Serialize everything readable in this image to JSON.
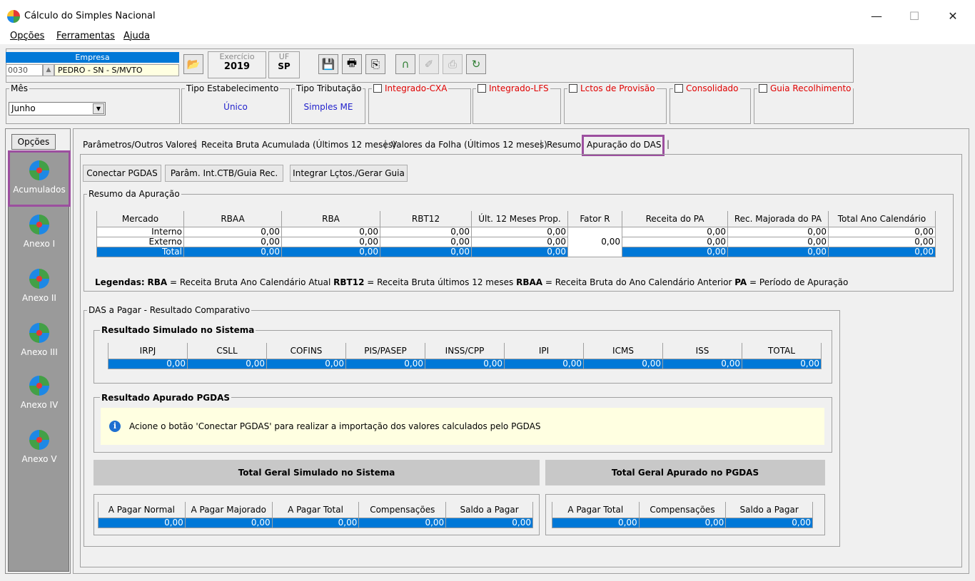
{
  "window": {
    "title": "Cálculo do Simples Nacional",
    "controls": {
      "minimize": "—",
      "maximize": "☐",
      "close": "✕"
    }
  },
  "menu": [
    "Opções",
    "Ferramentas",
    "Ajuda"
  ],
  "toolbar": {
    "empresa_label": "Empresa",
    "empresa_code": "0030",
    "empresa_name": "PEDRO - SN - S/MVTO",
    "exercicio_label": "Exercício",
    "exercicio_value": "2019",
    "uf_label": "UF",
    "uf_value": "SP",
    "icons": [
      "save-icon",
      "print-icon",
      "export-icon",
      "headset-icon",
      "disabled-tool-icon",
      "disabled-tool-icon-2",
      "refresh-icon"
    ]
  },
  "filters": {
    "mes_label": "Mês",
    "mes_value": "Junho",
    "tipo_estab_label": "Tipo Estabelecimento",
    "tipo_estab_value": "Único",
    "tipo_trib_label": "Tipo Tributação",
    "tipo_trib_value": "Simples ME",
    "checkboxes": [
      "Integrado-CXA",
      "Integrado-LFS",
      "Lctos de Provisão",
      "Consolidado",
      "Guia Recolhimento"
    ]
  },
  "sidebar": {
    "options_label": "Opções",
    "items": [
      "Acumulados",
      "Anexo I",
      "Anexo II",
      "Anexo III",
      "Anexo IV",
      "Anexo V"
    ]
  },
  "tabs": [
    "Parâmetros/Outros Valores",
    "Receita Bruta Acumulada (Últimos 12 meses)",
    "Valores da Folha (Últimos 12 meses)",
    "Resumo",
    "Apuração do DAS"
  ],
  "actions": [
    "Conectar PGDAS",
    "Parâm. Int.CTB/Guia Rec.",
    "Integrar Lçtos./Gerar Guia"
  ],
  "resumo": {
    "title": "Resumo da Apuração",
    "headers": [
      "Mercado",
      "RBAA",
      "RBA",
      "RBT12",
      "Últ. 12 Meses Prop.",
      "Fator R",
      "Receita do PA",
      "Rec. Majorada do PA",
      "Total Ano Calendário"
    ],
    "rows": [
      {
        "mercado": "Interno",
        "rbaa": "0,00",
        "rba": "0,00",
        "rbt12": "0,00",
        "ult12": "0,00",
        "receita_pa": "0,00",
        "rec_majorada": "0,00",
        "total_ano": "0,00"
      },
      {
        "mercado": "Externo",
        "rbaa": "0,00",
        "rba": "0,00",
        "rbt12": "0,00",
        "ult12": "0,00",
        "receita_pa": "0,00",
        "rec_majorada": "0,00",
        "total_ano": "0,00"
      },
      {
        "mercado": "Total",
        "rbaa": "0,00",
        "rba": "0,00",
        "rbt12": "0,00",
        "ult12": "0,00",
        "receita_pa": "0,00",
        "rec_majorada": "0,00",
        "total_ano": "0,00"
      }
    ],
    "fator_r": "0,00"
  },
  "legend": {
    "label": "Legendas:",
    "items": [
      {
        "k": "RBA",
        "v": " = Receita Bruta Ano Calendário Atual"
      },
      {
        "k": "RBT12",
        "v": " = Receita Bruta últimos 12 meses"
      },
      {
        "k": "RBAA",
        "v": " = Receita Bruta do Ano Calendário Anterior"
      },
      {
        "k": "PA",
        "v": " = Período de Apuração"
      }
    ]
  },
  "das": {
    "title": "DAS a Pagar - Resultado Comparativo",
    "simulado_title": "Resultado Simulado no Sistema",
    "simulado_headers": [
      "IRPJ",
      "CSLL",
      "COFINS",
      "PIS/PASEP",
      "INSS/CPP",
      "IPI",
      "ICMS",
      "ISS",
      "TOTAL"
    ],
    "simulado_values": [
      "0,00",
      "0,00",
      "0,00",
      "0,00",
      "0,00",
      "0,00",
      "0,00",
      "0,00",
      "0,00"
    ],
    "apurado_title": "Resultado Apurado PGDAS",
    "info_message": "Acione o botão 'Conectar PGDAS' para realizar a importação dos valores calculados pelo PGDAS",
    "total_simulado_title": "Total Geral Simulado no Sistema",
    "total_simulado_headers": [
      "A Pagar Normal",
      "A Pagar Majorado",
      "A Pagar Total",
      "Compensações",
      "Saldo a Pagar"
    ],
    "total_simulado_values": [
      "0,00",
      "0,00",
      "0,00",
      "0,00",
      "0,00"
    ],
    "total_apurado_title": "Total Geral Apurado no PGDAS",
    "total_apurado_headers": [
      "A Pagar Total",
      "Compensações",
      "Saldo a Pagar"
    ],
    "total_apurado_values": [
      "0,00",
      "0,00",
      "0,00"
    ]
  }
}
